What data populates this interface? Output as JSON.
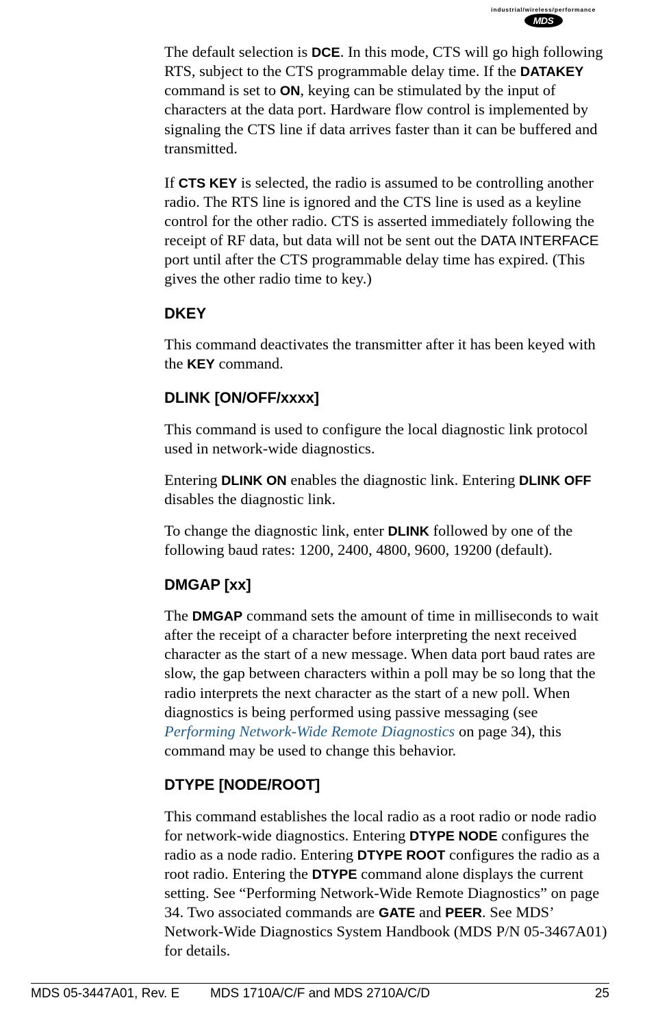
{
  "logo": {
    "tagline": "industrial/wireless/performance",
    "brand": "MDS"
  },
  "paragraphs": {
    "p1a": "The default selection is ",
    "p1_dce": "DCE",
    "p1b": ". In this mode, CTS will go high following RTS, subject to the CTS programmable delay time. If the ",
    "p1_datakey": "DATAKEY",
    "p1c": " command is set to ",
    "p1_on": "ON",
    "p1d": ", keying can be stimulated by the input of characters at the data port. Hardware flow control is implemented by signaling the CTS line if data arrives faster than it can be buffered and transmitted.",
    "p2a": "If ",
    "p2_ctskey": "CTS KEY",
    "p2b": " is selected, the radio is assumed to be controlling another radio. The RTS line is ignored and the CTS line is used as a keyline control for the other radio. CTS is asserted immediately following the receipt of RF data, but data will not be sent out the ",
    "p2_iface": "DATA INTERFACE",
    "p2c": " port until after the CTS programmable delay time has expired. (This gives the other radio time to key.)",
    "p3a": "This command deactivates the transmitter after it has been keyed with the ",
    "p3_key": "KEY",
    "p3b": " command.",
    "p4": "This command is used to configure the local diagnostic link protocol used in network-wide diagnostics.",
    "p5a": "Entering ",
    "p5_dlinkon": "DLINK ON",
    "p5b": " enables the diagnostic link. Entering ",
    "p5_dlinkoff": "DLINK OFF",
    "p5c": " disables the diagnostic link.",
    "p6a": "To change the diagnostic link, enter ",
    "p6_dlink": "DLINK",
    "p6b": " followed by one of the following baud rates: 1200, 2400, 4800, 9600, 19200 (default).",
    "p7a": "The ",
    "p7_dmgap": "DMGAP",
    "p7b": " command sets the amount of time in milliseconds to wait after the receipt of a character before interpreting the next received character as the start of a new message. When data port baud rates are slow, the gap between characters within a poll may be so long that the radio interprets the next character as the start of a new poll. When diagnostics is being performed using passive messaging (see ",
    "p7_link": "Performing Network-Wide Remote Diagnostics",
    "p7c": " on page 34), this command may be used to change this behavior.",
    "p8a": "This command establishes the local radio as a root radio or node radio for network-wide diagnostics. Entering ",
    "p8_dtypenode": "DTYPE NODE",
    "p8b": " configures the radio as a node radio. Entering ",
    "p8_dtyperoot": "DTYPE ROOT",
    "p8c": " configures the radio as a root radio. Entering the ",
    "p8_dtype": "DTYPE",
    "p8d": " command alone displays the current setting. See “Performing Network-Wide Remote Diagnostics” on page 34. Two associated commands are ",
    "p8_gate": "GATE",
    "p8e": " and ",
    "p8_peer": "PEER",
    "p8f": ". See MDS’ Network-Wide Diagnostics System Handbook (MDS P/N 05-3467A01) for details."
  },
  "headings": {
    "dkey": "DKEY",
    "dlink": "DLINK [ON/OFF/xxxx]",
    "dmgap": "DMGAP [xx]",
    "dtype": "DTYPE [NODE/ROOT]"
  },
  "footer": {
    "left": "MDS 05-3447A01, Rev. E",
    "center": "MDS 1710A/C/F and MDS 2710A/C/D",
    "right": "25"
  }
}
